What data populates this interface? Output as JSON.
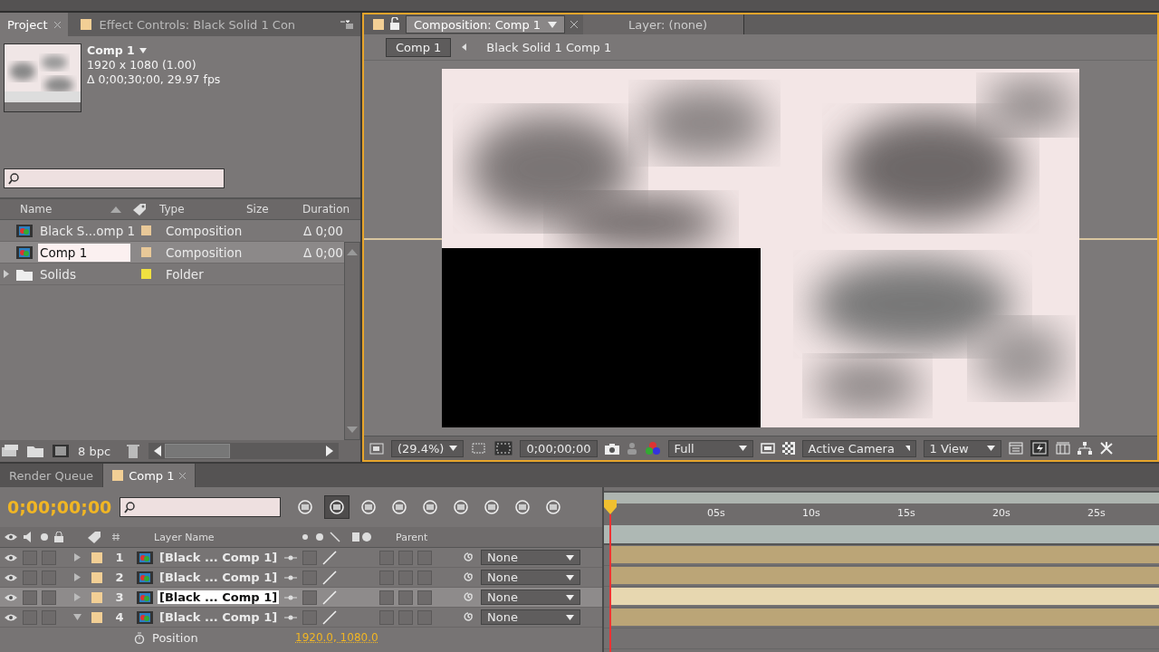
{
  "project_panel": {
    "tabs": [
      {
        "label": "Project",
        "selected": true
      },
      {
        "label": "Effect Controls: Black Solid 1 Con",
        "selected": false
      }
    ],
    "item_title": "Comp 1",
    "item_info": [
      "1920 x 1080 (1.00)",
      "Δ 0;00;30;00, 29.97 fps"
    ],
    "columns": [
      "Name",
      "Type",
      "Size",
      "Duration"
    ],
    "items": [
      {
        "kind": "composition",
        "name": "Black S...omp 1",
        "color": "#e8c898",
        "type": "Composition",
        "duration": "Δ 0;00",
        "selected": false,
        "renaming": false
      },
      {
        "kind": "composition",
        "name": "Comp 1",
        "color": "#e8c898",
        "type": "Composition",
        "duration": "Δ 0;00",
        "selected": true,
        "renaming": true
      },
      {
        "kind": "folder",
        "name": "Solids",
        "color": "#f0e040",
        "type": "Folder",
        "selected": false,
        "renaming": false
      }
    ],
    "bit_depth": "8 bpc"
  },
  "viewer": {
    "tabs": [
      {
        "label": "Composition: Comp 1",
        "selected": true
      },
      {
        "label": "Layer: (none)",
        "selected": false
      }
    ],
    "breadcrumbs": [
      {
        "label": "Comp 1",
        "selected": true
      },
      {
        "label": "Black Solid 1 Comp 1",
        "selected": false
      }
    ],
    "zoom": "(29.4%)",
    "timecode": "0;00;00;00",
    "resolution": "Full",
    "camera": "Active Camera",
    "views": "1 View"
  },
  "timeline": {
    "tabs": [
      {
        "label": "Render Queue",
        "selected": false
      },
      {
        "label": "Comp 1",
        "selected": true
      }
    ],
    "current_time": "0;00;00;00",
    "layer_name_column": "Layer Name",
    "parent_column": "Parent",
    "ruler_ticks": [
      "05s",
      "10s",
      "15s",
      "20s",
      "25s"
    ],
    "layers": [
      {
        "number": "1",
        "name": "[Black ... Comp 1]",
        "parent": "None",
        "expanded": false,
        "selected": false
      },
      {
        "number": "2",
        "name": "[Black ... Comp 1]",
        "parent": "None",
        "expanded": false,
        "selected": false
      },
      {
        "number": "3",
        "name": "[Black ... Comp 1]",
        "parent": "None",
        "expanded": false,
        "selected": true
      },
      {
        "number": "4",
        "name": "[Black ... Comp 1]",
        "parent": "None",
        "expanded": true,
        "selected": false,
        "properties": [
          {
            "name": "Position",
            "value": "1920.0, 1080.0"
          }
        ]
      }
    ]
  }
}
